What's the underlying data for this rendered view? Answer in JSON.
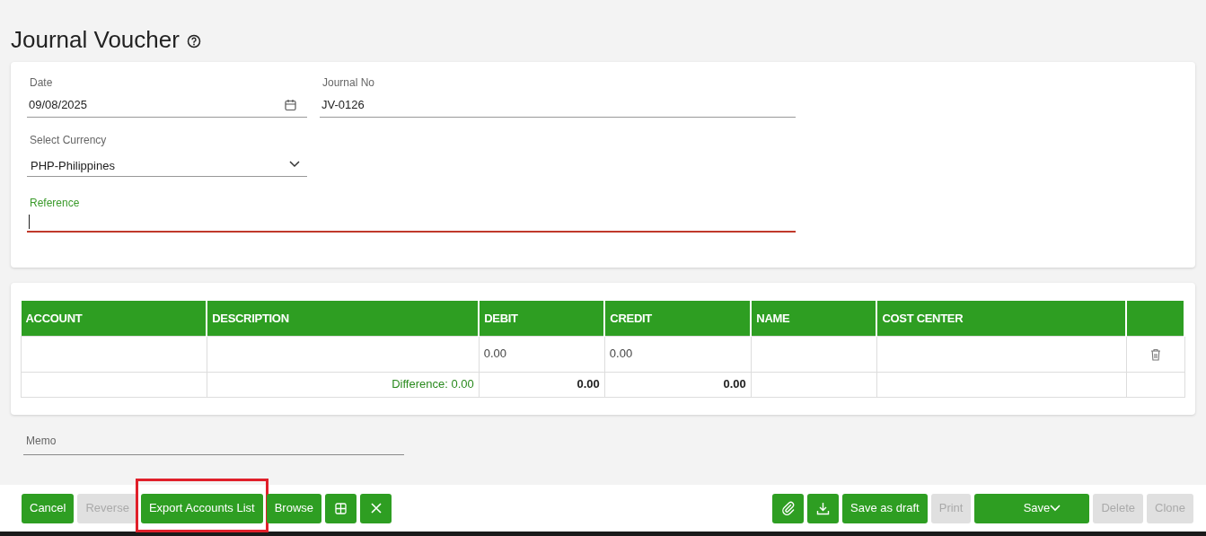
{
  "page": {
    "title": "Journal Voucher"
  },
  "form": {
    "date": {
      "label": "Date",
      "value": "09/08/2025"
    },
    "journal_no": {
      "label": "Journal No",
      "value": "JV-0126"
    },
    "currency": {
      "label": "Select Currency",
      "value": "PHP-Philippines"
    },
    "reference": {
      "label": "Reference",
      "focused": true,
      "invalid": true
    }
  },
  "table": {
    "columns": [
      "ACCOUNT",
      "DESCRIPTION",
      "DEBIT",
      "CREDIT",
      "NAME",
      "COST CENTER"
    ],
    "rows": [
      {
        "debit": "0.00",
        "credit": "0.00"
      }
    ],
    "totals": {
      "difference": "Difference: 0.00",
      "debit": "0.00",
      "credit": "0.00"
    }
  },
  "memo": {
    "label": "Memo"
  },
  "footer_left": [
    {
      "kind": "text",
      "label": "Cancel",
      "disabled": false
    },
    {
      "kind": "text",
      "label": "Reverse",
      "disabled": true
    },
    {
      "kind": "text",
      "label": "Export Accounts List",
      "disabled": false,
      "highlighted": true
    },
    {
      "kind": "text",
      "label": "Browse",
      "disabled": false
    },
    {
      "kind": "grid",
      "disabled": false
    },
    {
      "kind": "close",
      "disabled": false
    }
  ],
  "footer_right": [
    {
      "kind": "attach",
      "disabled": false
    },
    {
      "kind": "download",
      "disabled": false
    },
    {
      "kind": "text",
      "label": "Save as draft",
      "disabled": false
    },
    {
      "kind": "text",
      "label": "Print",
      "disabled": true
    },
    {
      "kind": "split",
      "label": "Save",
      "disabled": false
    },
    {
      "kind": "text",
      "label": "Delete",
      "disabled": true
    },
    {
      "kind": "text",
      "label": "Clone",
      "disabled": true
    }
  ]
}
